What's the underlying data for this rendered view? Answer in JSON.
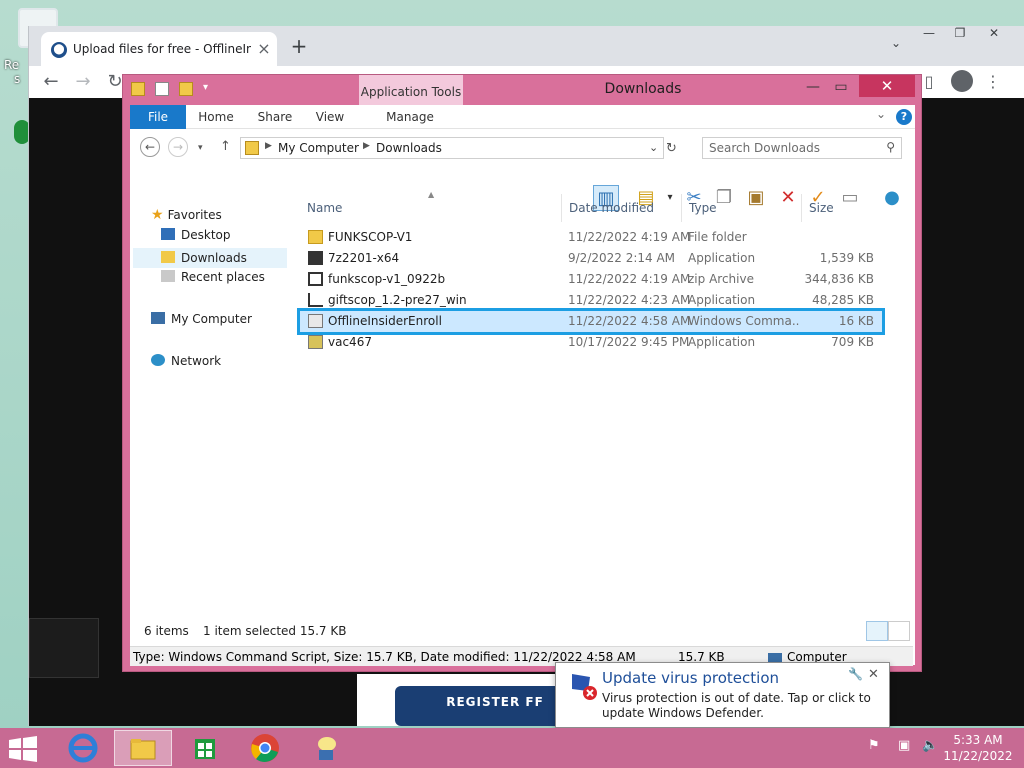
{
  "desktop": {
    "icon_label_1": "Re",
    "icon_label_2": "s"
  },
  "browser": {
    "tab_title": "Upload files for free - OfflineInsi",
    "tab_close": "×",
    "new_tab": "+",
    "page_button": "REGISTER FF"
  },
  "explorer": {
    "title": "Downloads",
    "context_tab": "Application Tools",
    "ribbon_tabs": [
      "File",
      "Home",
      "Share",
      "View",
      "Manage"
    ],
    "breadcrumb": [
      "My Computer",
      "Downloads"
    ],
    "search_placeholder": "Search Downloads",
    "nav": {
      "favorites": "Favorites",
      "desktop": "Desktop",
      "downloads": "Downloads",
      "recent": "Recent places",
      "computer": "My Computer",
      "network": "Network"
    },
    "columns": [
      "Name",
      "Date modified",
      "Type",
      "Size"
    ],
    "files": [
      {
        "name": "FUNKSCOP-V1",
        "date": "11/22/2022 4:19 AM",
        "type": "File folder",
        "size": ""
      },
      {
        "name": "7z2201-x64",
        "date": "9/2/2022 2:14 AM",
        "type": "Application",
        "size": "1,539 KB"
      },
      {
        "name": "funkscop-v1_0922b",
        "date": "11/22/2022 4:19 AM",
        "type": "zip Archive",
        "size": "344,836 KB"
      },
      {
        "name": "giftscop_1.2-pre27_win",
        "date": "11/22/2022 4:23 AM",
        "type": "Application",
        "size": "48,285 KB"
      },
      {
        "name": "OfflineInsiderEnroll",
        "date": "11/22/2022 4:58 AM",
        "type": "Windows Comma...",
        "size": "16 KB"
      },
      {
        "name": "vac467",
        "date": "10/17/2022 9:45 PM",
        "type": "Application",
        "size": "709 KB"
      }
    ],
    "status": {
      "items": "6 items",
      "selected": "1 item selected  15.7 KB"
    },
    "detail": {
      "info": "Type: Windows Command Script, Size: 15.7 KB, Date modified: 11/22/2022 4:58 AM",
      "size": "15.7 KB",
      "location": "Computer"
    }
  },
  "notification": {
    "title": "Update virus protection",
    "body": "Virus protection is out of date. Tap or click to update Windows Defender."
  },
  "taskbar": {
    "time": "5:33 AM",
    "date": "11/22/2022"
  },
  "colors": {
    "explorer_frame": "#d9709b",
    "selection_outline": "#1c9ee3",
    "file_tab": "#1979ca",
    "taskbar": "#c76a93"
  }
}
